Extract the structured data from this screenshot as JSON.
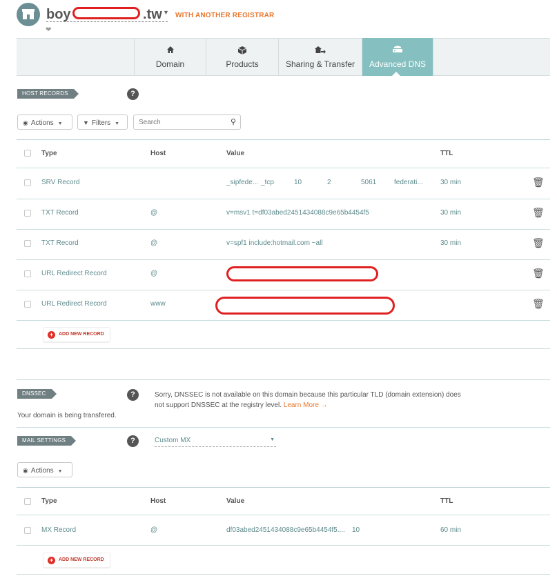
{
  "header": {
    "domain_prefix": "boy",
    "domain_suffix": ".tw",
    "registrar_note": "WITH ANOTHER REGISTRAR"
  },
  "tabs": [
    {
      "label": "Domain",
      "icon": "home-icon"
    },
    {
      "label": "Products",
      "icon": "box-icon"
    },
    {
      "label": "Sharing & Transfer",
      "icon": "share-transfer-icon"
    },
    {
      "label": "Advanced DNS",
      "icon": "dns-server-icon",
      "active": true
    }
  ],
  "host_records": {
    "tag": "HOST RECORDS",
    "help": "?",
    "actions_label": "Actions",
    "filters_label": "Filters",
    "search_placeholder": "Search",
    "columns": {
      "type": "Type",
      "host": "Host",
      "value": "Value",
      "ttl": "TTL"
    },
    "srv": {
      "type": "SRV Record",
      "service": "_sipfede...",
      "protocol": "_tcp",
      "priority": "10",
      "weight": "2",
      "port": "5061",
      "target": "federati...",
      "ttl": "30 min"
    },
    "txt1": {
      "type": "TXT Record",
      "host": "@",
      "value": "v=msv1 t=df03abed2451434088c9e65b4454f5",
      "ttl": "30 min"
    },
    "txt2": {
      "type": "TXT Record",
      "host": "@",
      "value": "v=spf1 include:hotmail.com ~all",
      "ttl": "30 min"
    },
    "url1": {
      "type": "URL Redirect Record",
      "host": "@"
    },
    "url2": {
      "type": "URL Redirect Record",
      "host": "www"
    },
    "add_label": "ADD NEW RECORD"
  },
  "dnssec": {
    "tag": "DNSSEC",
    "help": "?",
    "transfer_status": "Your domain is being transfered.",
    "message_line1": "Sorry, DNSSEC is not available on this domain because this particular TLD (domain extension) does",
    "message_line2": "not support DNSSEC at the registry level.",
    "learn_more": "Learn More →"
  },
  "mail": {
    "tag": "MAIL SETTINGS",
    "help": "?",
    "mode": "Custom MX",
    "actions_label": "Actions",
    "columns": {
      "type": "Type",
      "host": "Host",
      "value": "Value",
      "ttl": "TTL"
    },
    "mx": {
      "type": "MX Record",
      "host": "@",
      "value": "df03abed2451434088c9e65b4454f5....",
      "priority": "10",
      "ttl": "60 min"
    },
    "add_label": "ADD NEW RECORD"
  },
  "colors": {
    "accent_tab": "#86bfbf",
    "registrar": "#e8772e",
    "add_red": "#e0302a",
    "value_text": "#5d8a8c"
  }
}
